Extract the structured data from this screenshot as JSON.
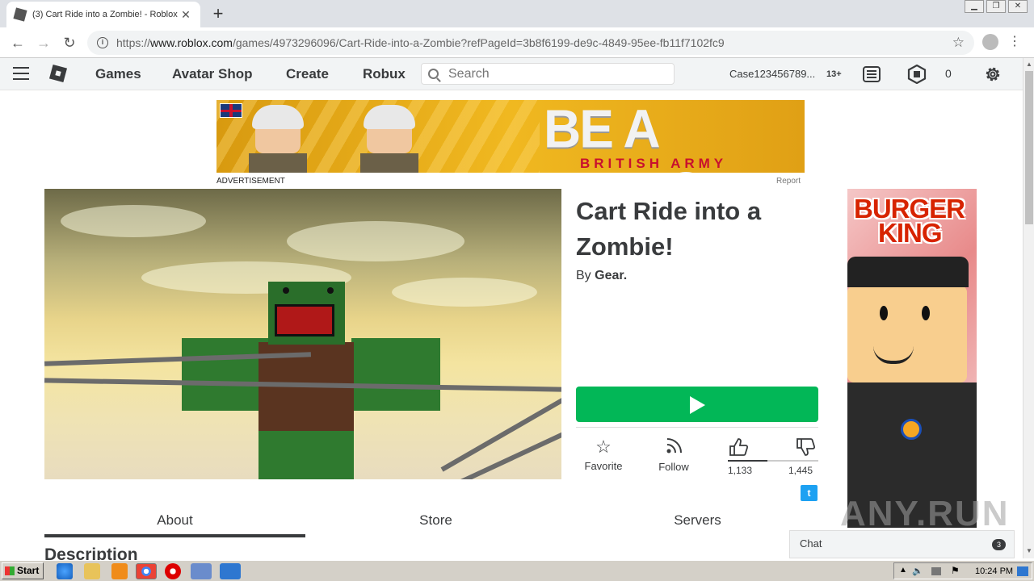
{
  "browser": {
    "tab_title": "(3) Cart Ride into a Zombie! - Roblox",
    "tab_close": "✕",
    "new_tab": "+",
    "url_prefix": "https://",
    "url_domain": "www.roblox.com",
    "url_path": "/games/4973296096/Cart-Ride-into-a-Zombie?refPageId=3b8f6199-de9c-4849-95ee-fb11f7102fc9",
    "info_glyph": "i",
    "window_controls": [
      "▁",
      "❐",
      "✕"
    ]
  },
  "nav": {
    "links": [
      "Games",
      "Avatar Shop",
      "Create",
      "Robux"
    ],
    "search_placeholder": "Search",
    "username": "Case123456789...",
    "age_label": "13+",
    "robux_balance": "0"
  },
  "ad_top": {
    "headline": "BE A MEDIC",
    "subline": "BRITISH ARMY",
    "label": "ADVERTISEMENT",
    "report": "Report"
  },
  "game": {
    "title": "Cart Ride into a Zombie!",
    "by_prefix": "By",
    "creator": "Gear.",
    "actions": {
      "favorite": "Favorite",
      "follow": "Follow"
    },
    "upvotes": "1,133",
    "downvotes": "1,445",
    "vote_ratio": 0.44,
    "twitter_glyph": "t"
  },
  "side_ad": {
    "brand_line1": "BURGER",
    "brand_line2": "KING"
  },
  "page_tabs": [
    "About",
    "Store",
    "Servers"
  ],
  "active_tab": "About",
  "description_heading": "Description",
  "chat": {
    "label": "Chat",
    "count": "3"
  },
  "watermark": "ANY.RUN",
  "taskbar": {
    "start_label": "Start",
    "clock": "10:24 PM"
  },
  "colors": {
    "play_green": "#02b757",
    "nav_bg": "#f2f4f5",
    "text": "#393b3d",
    "twitter": "#1da1f2"
  }
}
